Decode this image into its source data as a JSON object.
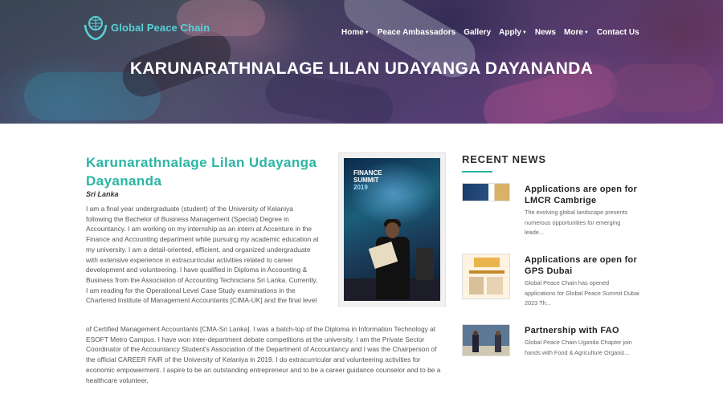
{
  "header": {
    "logo_text": "Global Peace Chain",
    "nav": [
      {
        "label": "Home",
        "dropdown": true
      },
      {
        "label": "Peace Ambassadors",
        "dropdown": false
      },
      {
        "label": "Gallery",
        "dropdown": false
      },
      {
        "label": "Apply",
        "dropdown": true
      },
      {
        "label": "News",
        "dropdown": false
      },
      {
        "label": "More",
        "dropdown": true
      },
      {
        "label": "Contact Us",
        "dropdown": false
      }
    ],
    "hero_title": "KARUNARATHNALAGE LILAN UDAYANGA DAYANANDA"
  },
  "profile": {
    "name": "Karunarathnalage Lilan Udayanga Dayananda",
    "country": "Sri Lanka",
    "bio_part1": "I am a final year undergraduate (student) of the University of Kelaniya following the Bachelor of Business Management (Special) Degree in Accountancy. I am working on my internship as an intern at Accenture in the Finance and Accounting department while pursuing my academic education at my university. I am a detail-oriented, efficient, and organized undergraduate with extensive experience in extracurricular activities related to career development and volunteering. I have qualified in Diploma in Accounting & Business from the Association of Accounting Technicians Sri Lanka. Currently, I am reading for the Operational Level Case Study examinations in the Chartered Institute of Management Accountants [CIMA-UK] and the final level",
    "bio_part2": "of Certified Management Accountants [CMA-Sri Lanka]. I was a batch-top of the Diploma in Information Technology at ESOFT Metro Campus. I have won inter-department debate competitions at the university. I am the Private Sector Coordinator of the Accountancy Student's Association of the Department of Accountancy and I was the Chairperson of the official CAREER FAIR of the University of Kelaniya in 2019. I do extracurricular and volunteering activities for economic empowerment. I aspire to be an outstanding entrepreneur and to be a career guidance counselor and to be a healthcare volunteer.",
    "photo_text": {
      "line1": "FINANCE",
      "line2": "SUMMIT",
      "line3": "2019"
    }
  },
  "sidebar": {
    "title": "RECENT NEWS",
    "items": [
      {
        "title": "Applications are open for LMCR Cambrige",
        "excerpt": "The evolving global landscape presents numerous opportunities for emerging leade..."
      },
      {
        "title": "Applications are open for GPS Dubai",
        "excerpt": "Global Peace Chain has opened applications for Global Peace Summit Dubai 2023 Th..."
      },
      {
        "title": "Partnership with FAO",
        "excerpt": "Global Peace Chain Uganda Chapter join hands with Food & Agriculture Organiz..."
      }
    ]
  },
  "colors": {
    "accent": "#2bb5a4",
    "logo": "#58d2d6"
  }
}
